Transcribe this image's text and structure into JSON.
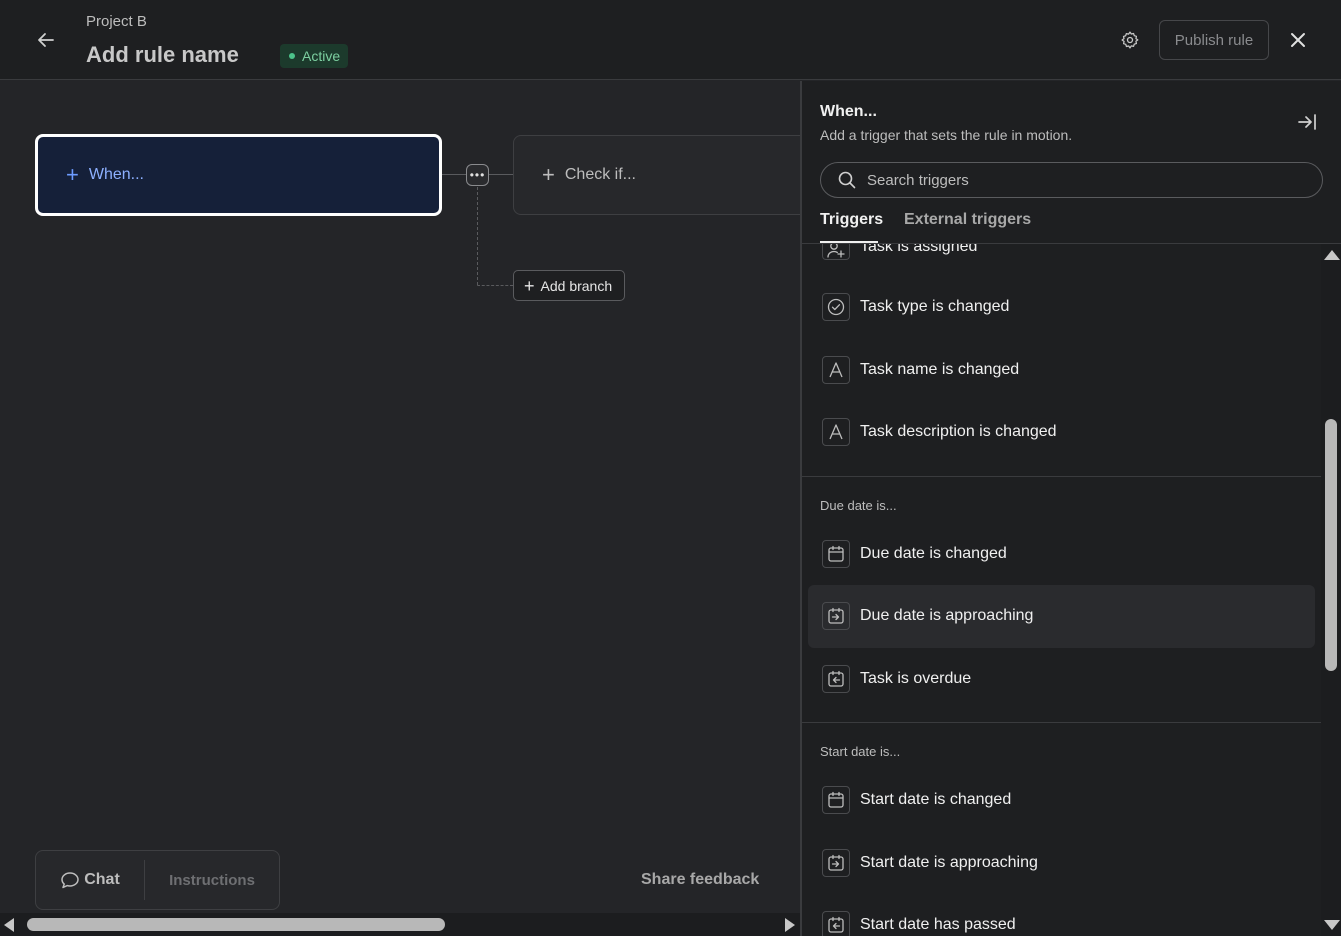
{
  "header": {
    "project_name": "Project B",
    "rule_name": "Add rule name",
    "status": "Active",
    "publish_label": "Publish rule"
  },
  "canvas": {
    "when_label": "When...",
    "check_label": "Check if...",
    "add_branch_label": "Add branch",
    "chat_label": "Chat",
    "instructions_label": "Instructions",
    "share_feedback_label": "Share feedback"
  },
  "panel": {
    "title": "When...",
    "subtitle": "Add a trigger that sets the rule in motion.",
    "search_placeholder": "Search triggers",
    "tabs": [
      "Triggers",
      "External triggers"
    ],
    "group_task_items": [
      {
        "icon": "user-plus-icon",
        "label": "Task is assigned"
      },
      {
        "icon": "check-circle-icon",
        "label": "Task type is changed"
      },
      {
        "icon": "text-a-icon",
        "label": "Task name is changed"
      },
      {
        "icon": "text-a-icon",
        "label": "Task description is changed"
      }
    ],
    "group_due_label": "Due date is...",
    "group_due_items": [
      {
        "icon": "calendar-icon",
        "label": "Due date is changed"
      },
      {
        "icon": "calendar-arrow-in-icon",
        "label": "Due date is approaching"
      },
      {
        "icon": "calendar-arrow-out-icon",
        "label": "Task is overdue"
      }
    ],
    "group_start_label": "Start date is...",
    "group_start_items": [
      {
        "icon": "calendar-icon",
        "label": "Start date is changed"
      },
      {
        "icon": "calendar-arrow-in-icon",
        "label": "Start date is approaching"
      },
      {
        "icon": "calendar-arrow-out-icon",
        "label": "Start date has passed"
      }
    ]
  },
  "colors": {
    "accent_blue": "#6d9cff",
    "active_green": "#4cc38a",
    "background": "#242528"
  }
}
